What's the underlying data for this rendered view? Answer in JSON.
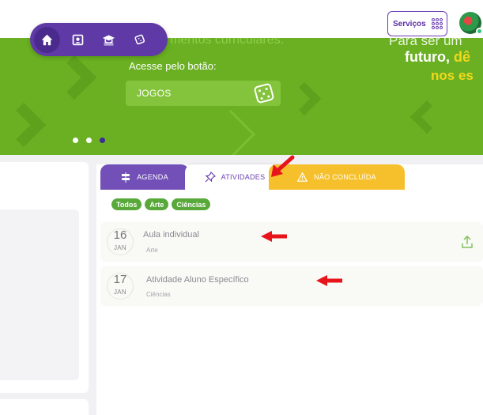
{
  "header": {
    "services_label": "Serviços",
    "avatar_name": "user-avatar"
  },
  "nav": {
    "items": [
      {
        "name": "home",
        "icon": "home-icon",
        "active": true
      },
      {
        "name": "profile",
        "icon": "id-card-icon",
        "active": false
      },
      {
        "name": "school",
        "icon": "graduation-cap-icon",
        "active": false
      },
      {
        "name": "games",
        "icon": "dice-icon",
        "active": false
      }
    ]
  },
  "banner": {
    "headline_partial_top": "mentos curriculares.",
    "headline_partial_right": "Para ser um",
    "line1_text": "futuro, ",
    "line1_highlight": "dê",
    "line2_highlight": "nos es",
    "access_text": "Acesse pelo botão:",
    "button_label": "JOGOS",
    "carousel_dots": 3,
    "active_dot": 3,
    "colors": {
      "bg": "#6ab022",
      "button": "#84c43c",
      "highlight": "#f3d81d"
    }
  },
  "tabs": [
    {
      "label": "AGENDA",
      "icon": "signpost-icon",
      "color": "#7250b8"
    },
    {
      "label": "ATIVIDADES",
      "icon": "pin-icon",
      "color": "#ffffff",
      "active": true
    },
    {
      "label": "NÃO CONCLUÍDA",
      "icon": "warning-icon",
      "color": "#f6c02c"
    }
  ],
  "filters": [
    "Todos",
    "Arte",
    "Ciências"
  ],
  "activities": [
    {
      "day": "16",
      "month": "JAN",
      "title": "Aula individual",
      "subject": "Arte",
      "has_upload": true
    },
    {
      "day": "17",
      "month": "JAN",
      "title": "Atividade Aluno Específico",
      "subject": "Ciências",
      "has_upload": false
    }
  ],
  "annotations": {
    "arrow_color": "#e8141b"
  }
}
